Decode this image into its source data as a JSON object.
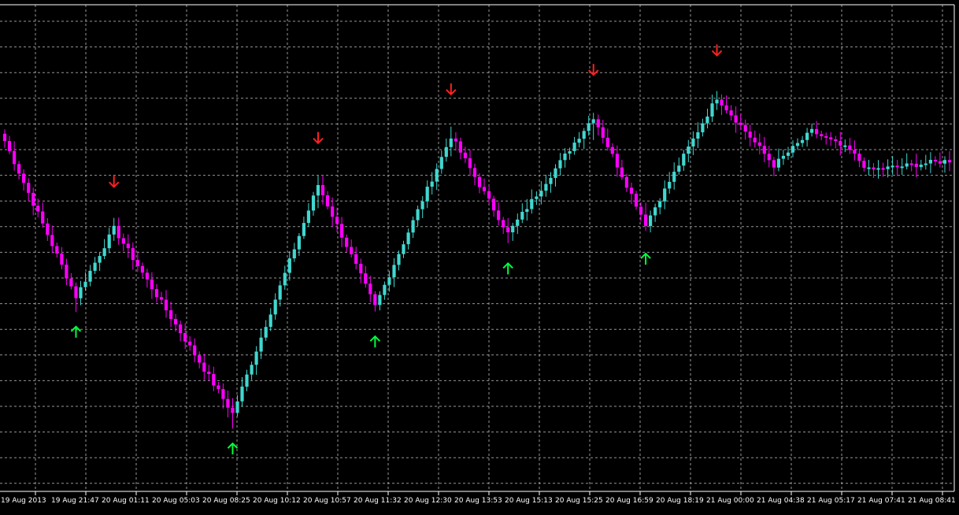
{
  "colors": {
    "background": "#000000",
    "grid": "#c8c8c8",
    "axis": "#ffffff",
    "bull": "#40d8d0",
    "bear": "#ff00ff",
    "wick_bull": "#40d8d0",
    "wick_bear": "#ff00ff",
    "signal_up": "#00ff40",
    "signal_down": "#ff2020",
    "label": "#ffffff"
  },
  "icons": {
    "signal_up": "up-arrow-icon",
    "signal_down": "down-arrow-icon"
  },
  "chart_data": {
    "type": "candlestick",
    "grid": true,
    "x_tick_labels": [
      "19 Aug 2013",
      "19 Aug 21:47",
      "20 Aug 01:11",
      "20 Aug 05:03",
      "20 Aug 08:25",
      "20 Aug 10:12",
      "20 Aug 10:57",
      "20 Aug 11:32",
      "20 Aug 12:30",
      "20 Aug 13:53",
      "20 Aug 15:13",
      "20 Aug 15:25",
      "20 Aug 16:59",
      "20 Aug 18:19",
      "21 Aug 00:00",
      "21 Aug 04:38",
      "21 Aug 05:17",
      "21 Aug 07:41",
      "21 Aug 08:41"
    ],
    "ylim": [
      0,
      100
    ],
    "pivots": [
      [
        0,
        72
      ],
      [
        15,
        40
      ],
      [
        23,
        54
      ],
      [
        48,
        16
      ],
      [
        66,
        63
      ],
      [
        78,
        38
      ],
      [
        94,
        73
      ],
      [
        106,
        53
      ],
      [
        124,
        77
      ],
      [
        135,
        55
      ],
      [
        150,
        81
      ],
      [
        162,
        67
      ],
      [
        170,
        74
      ],
      [
        178,
        70
      ],
      [
        182,
        66
      ],
      [
        199,
        68
      ]
    ],
    "signals_down": [
      23,
      66,
      94,
      124,
      150
    ],
    "signals_up": [
      15,
      48,
      78,
      106,
      135
    ]
  }
}
